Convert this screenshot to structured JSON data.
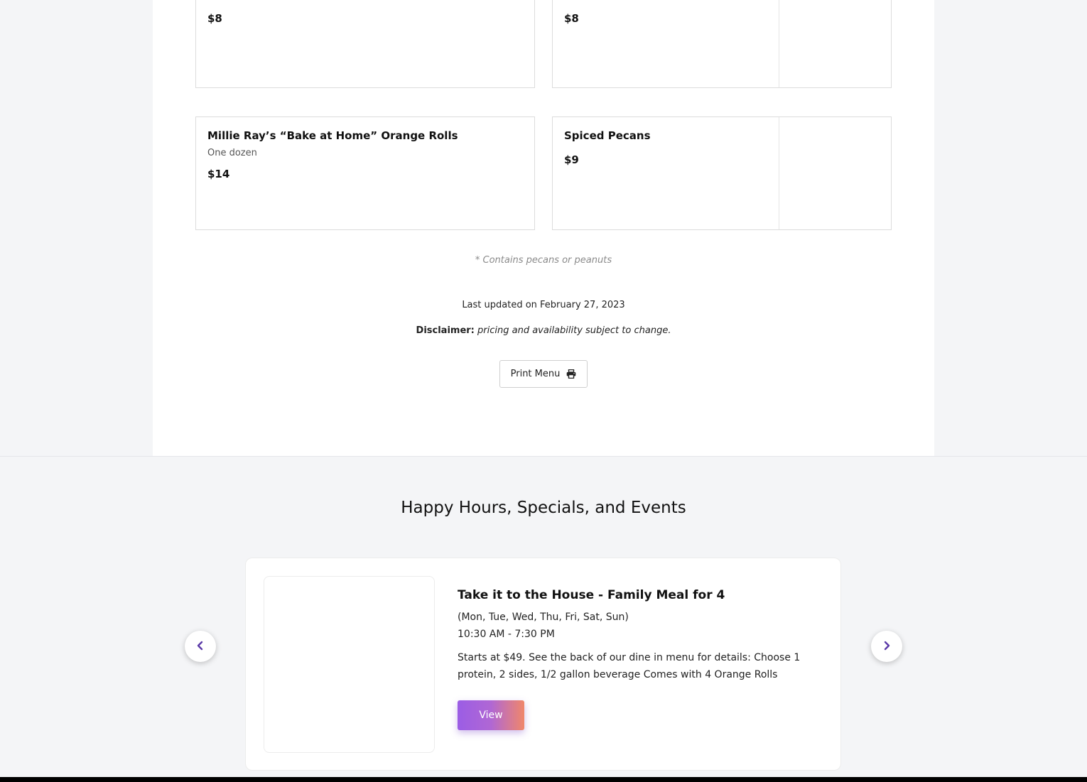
{
  "menu": {
    "items": [
      {
        "name": "",
        "description": "",
        "price": "$8"
      },
      {
        "name": "",
        "description": "",
        "price": "$8"
      },
      {
        "name": "Millie Ray’s “Bake at Home” Orange Rolls",
        "description": "One dozen",
        "price": "$14"
      },
      {
        "name": "Spiced Pecans",
        "description": "",
        "price": "$9"
      }
    ],
    "allergen_note": "* Contains pecans or peanuts",
    "last_updated": "Last updated on February 27, 2023",
    "disclaimer_label": "Disclaimer:",
    "disclaimer_text": "pricing and availability subject to change.",
    "print_label": "Print Menu",
    "print_icon": "printer-icon"
  },
  "events": {
    "heading": "Happy Hours, Specials, and Events",
    "current": {
      "title": "Take it to the House - Family Meal for 4",
      "days": "(Mon, Tue, Wed, Thu, Fri, Sat, Sun)",
      "time": "10:30 AM - 7:30 PM",
      "description": "Starts at $49. See the back of our dine in menu for details: Choose 1 protein, 2 sides, 1/2 gallon beverage Comes with 4 Orange Rolls",
      "button_label": "View"
    },
    "prev_icon": "chevron-left-icon",
    "next_icon": "chevron-right-icon"
  },
  "colors": {
    "accent_start": "#9b5de5",
    "accent_end": "#f0876a",
    "arrow_color": "#5b3aa8",
    "page_background": "#f4f5f7"
  }
}
